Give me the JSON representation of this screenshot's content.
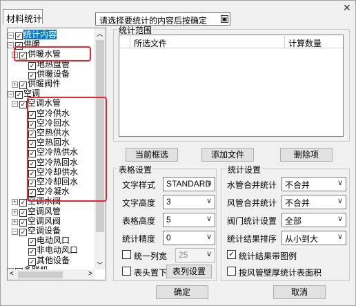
{
  "window": {
    "tab_label": "材料统计",
    "tooltip": "请选择要统计的内容后按确定",
    "tooltip_icon": "▣",
    "close_glyph": "✕"
  },
  "tree": {
    "items": [
      {
        "label": "统计内容",
        "checked": true,
        "expander": "−"
      },
      {
        "label": "供暖",
        "checked": true,
        "expander": "−"
      },
      {
        "label": "供暖水管",
        "checked": true,
        "expander": "+"
      },
      {
        "label": "地热盘管",
        "checked": true,
        "expander": ""
      },
      {
        "label": "供暖设备",
        "checked": true,
        "expander": ""
      },
      {
        "label": "供暖阀件",
        "checked": true,
        "expander": "+"
      },
      {
        "label": "空调",
        "checked": true,
        "expander": "−"
      },
      {
        "label": "空调水管",
        "checked": true,
        "expander": "−"
      },
      {
        "label": "空冷供水",
        "checked": true,
        "expander": ""
      },
      {
        "label": "空冷回水",
        "checked": true,
        "expander": ""
      },
      {
        "label": "空热供水",
        "checked": true,
        "expander": ""
      },
      {
        "label": "空热回水",
        "checked": true,
        "expander": ""
      },
      {
        "label": "空冷热供水",
        "checked": true,
        "expander": ""
      },
      {
        "label": "空冷热回水",
        "checked": true,
        "expander": ""
      },
      {
        "label": "空冷却供水",
        "checked": true,
        "expander": ""
      },
      {
        "label": "空冷却回水",
        "checked": true,
        "expander": ""
      },
      {
        "label": "空冷凝水",
        "checked": true,
        "expander": ""
      },
      {
        "label": "空调水阀",
        "checked": true,
        "expander": "+"
      },
      {
        "label": "空调风管",
        "checked": true,
        "expander": "+"
      },
      {
        "label": "空调风阀",
        "checked": true,
        "expander": "+"
      },
      {
        "label": "空调设备",
        "checked": true,
        "expander": "−"
      },
      {
        "label": "电动风口",
        "checked": true,
        "expander": ""
      },
      {
        "label": "非电动风口",
        "checked": true,
        "expander": ""
      },
      {
        "label": "其他设备",
        "checked": true,
        "expander": ""
      },
      {
        "label": "多联机",
        "checked": true,
        "expander": "+"
      }
    ],
    "check_glyph": "✓",
    "scroll_up": "︿",
    "scroll_down": "﹀",
    "scroll_left": "<",
    "scroll_right": ">"
  },
  "stat_range": {
    "group_label": "统计范围",
    "columns": [
      "所选文件",
      "计算数量"
    ],
    "rows": []
  },
  "actions": {
    "current_frame": "当前框选",
    "add_file": "添加文件",
    "delete_item": "删除项"
  },
  "table_settings": {
    "group_label": "表格设置",
    "text_style_label": "文字样式",
    "text_style_value": "STANDARD",
    "text_height_label": "文字高度",
    "text_height_value": "3",
    "table_height_label": "表格高度",
    "table_height_value": "5",
    "precision_label": "统计精度",
    "precision_value": "0",
    "uniform_width_label": "统一列宽",
    "uniform_width_checked": false,
    "uniform_width_value": "25",
    "header_bottom_label": "表头置下",
    "header_bottom_checked": false,
    "column_setting_button": "表列设置"
  },
  "stat_settings": {
    "group_label": "统计设置",
    "pipe_merge_label": "水管合并统计",
    "pipe_merge_value": "不合并",
    "duct_merge_label": "风管合并统计",
    "duct_merge_value": "不合并",
    "valve_label": "阀门统计设置",
    "valve_value": "全部",
    "sort_label": "统计结果排序",
    "sort_value": "从小到大",
    "legend_label": "统计结果带图例",
    "legend_checked": true,
    "wall_thickness_label": "按风管壁厚统计表面积",
    "wall_thickness_checked": false
  },
  "footer": {
    "ok": "确定",
    "cancel": "取消"
  },
  "combo_arrow": "∨"
}
